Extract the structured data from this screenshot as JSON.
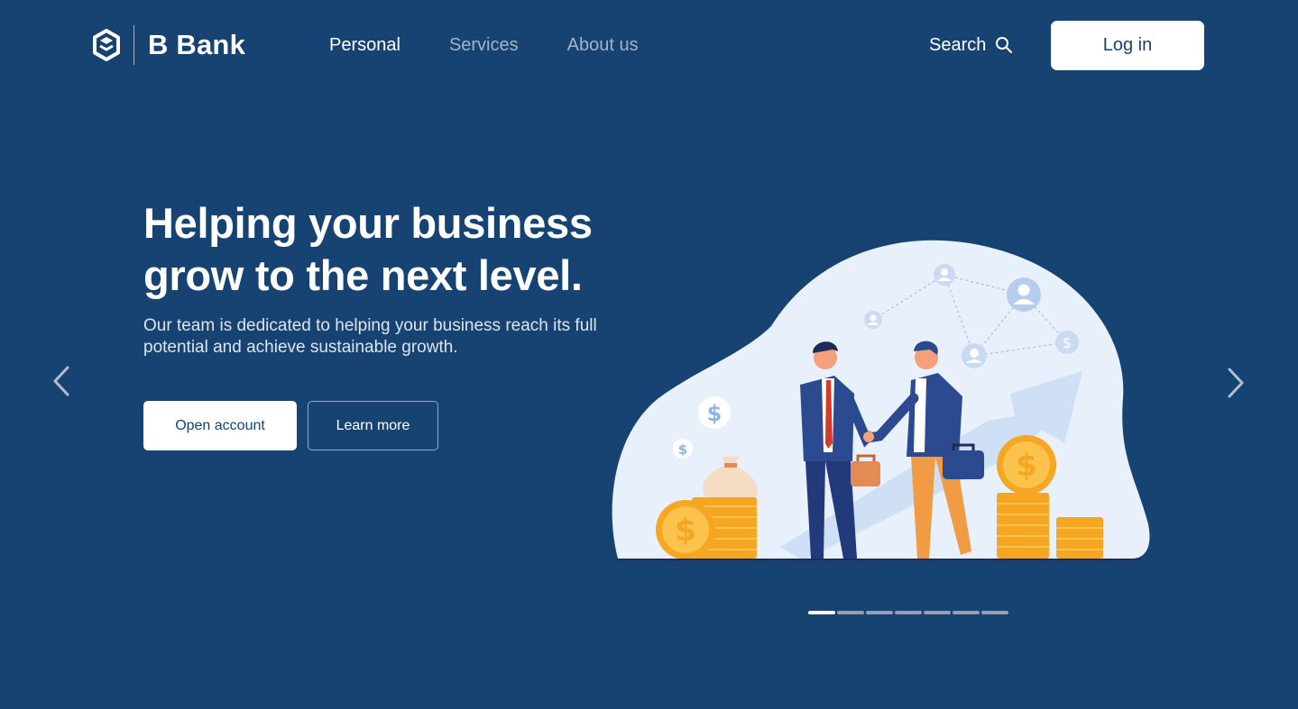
{
  "header": {
    "brand": "B Bank",
    "nav": [
      {
        "label": "Personal",
        "active": true
      },
      {
        "label": "Services",
        "active": false
      },
      {
        "label": "About us",
        "active": false
      }
    ],
    "search_label": "Search",
    "login_label": "Log in"
  },
  "hero": {
    "title": "Helping your business grow to the next level.",
    "subtitle": "Our team is dedicated to helping your business reach its full potential and achieve sustainable growth.",
    "primary_button": "Open account",
    "secondary_button": "Learn more"
  },
  "carousel": {
    "total_slides": 7,
    "active_slide": 1
  },
  "colors": {
    "background": "#174372",
    "accent": "#ffffff",
    "muted_nav": "#9fb4cd",
    "coin": "#f9b531",
    "blob": "#e8f0fb"
  },
  "icons": [
    "logo-mark-icon",
    "search-icon",
    "chevron-left-icon",
    "chevron-right-icon"
  ]
}
